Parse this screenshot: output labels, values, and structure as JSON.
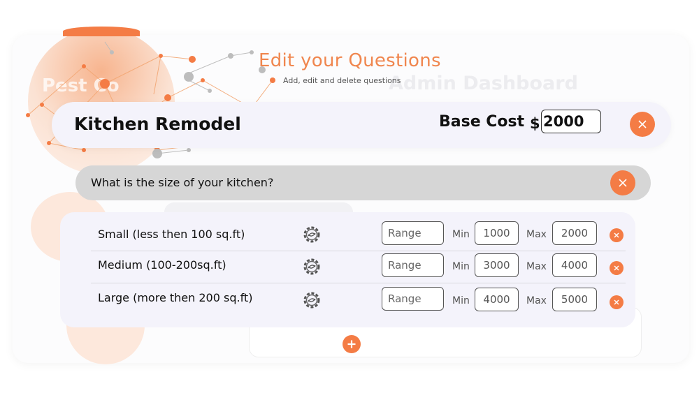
{
  "header": {
    "title": "Edit your Questions",
    "subtitle": "Add, edit and delete questions"
  },
  "background": {
    "dashboard_title": "Admin Dashboard",
    "brand_text": "Pest Co"
  },
  "service": {
    "name": "Kitchen Remodel",
    "base_cost_label": "Base Cost",
    "currency_symbol": "$",
    "base_cost_value": "2000"
  },
  "question": {
    "text": "What is the size of your kitchen?"
  },
  "options": [
    {
      "label": "Small (less then 100 sq.ft)",
      "type_placeholder": "Range",
      "min_label": "Min",
      "min_value": "1000",
      "max_label": "Max",
      "max_value": "2000"
    },
    {
      "label": "Medium (100-200sq.ft)",
      "type_placeholder": "Range",
      "min_label": "Min",
      "min_value": "3000",
      "max_label": "Max",
      "max_value": "4000"
    },
    {
      "label": "Large (more then 200 sq.ft)",
      "type_placeholder": "Range",
      "min_label": "Min",
      "min_value": "4000",
      "max_label": "Max",
      "max_value": "5000"
    }
  ],
  "colors": {
    "accent": "#f47c45",
    "title": "#f0864e",
    "card_bg": "#f4f3fb",
    "question_bg": "#d6d6d6"
  },
  "icons": {
    "close": "close-icon",
    "settings": "gear-icon",
    "add": "plus-icon"
  }
}
